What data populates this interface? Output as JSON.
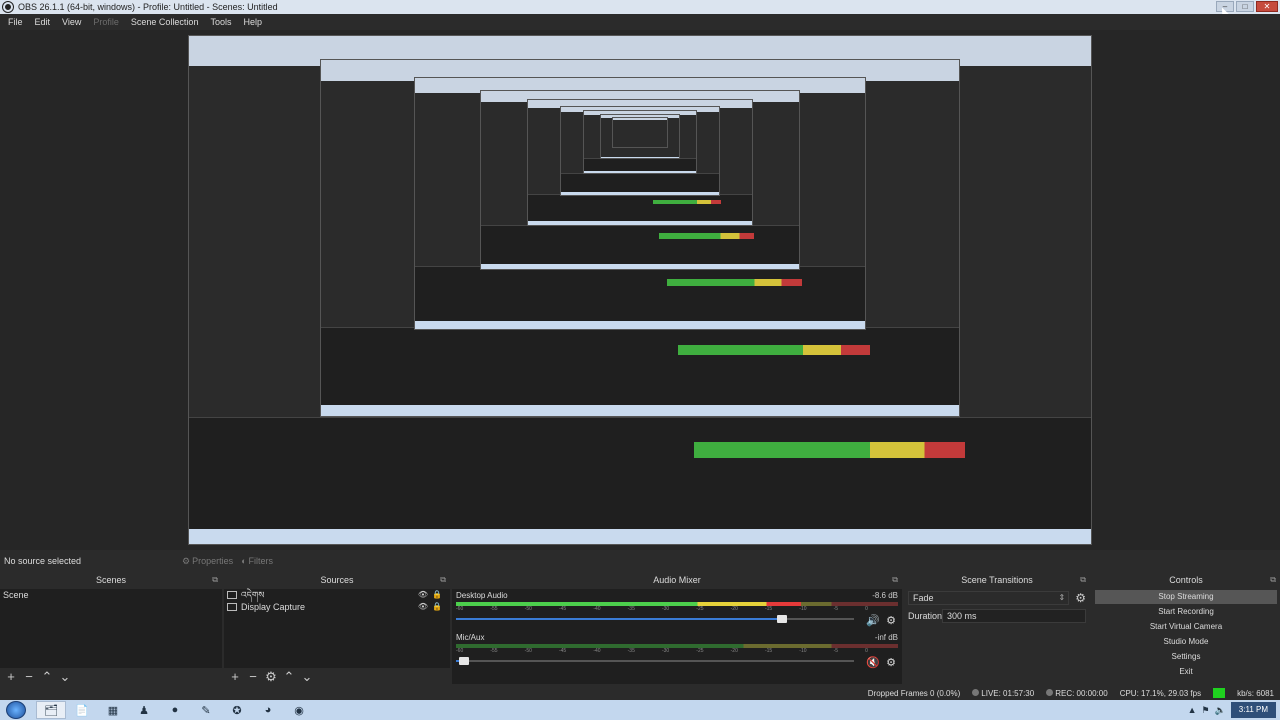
{
  "window": {
    "title": "OBS 26.1.1 (64-bit, windows) - Profile: Untitled - Scenes: Untitled",
    "min": "–",
    "max": "□",
    "close": "✕"
  },
  "menu": [
    "File",
    "Edit",
    "View",
    "Profile",
    "Scene Collection",
    "Tools",
    "Help"
  ],
  "source_toolbar": {
    "no_source": "No source selected",
    "properties": "Properties",
    "filters": "Filters"
  },
  "docks": {
    "scenes": {
      "title": "Scenes",
      "items": [
        "Scene"
      ]
    },
    "sources": {
      "title": "Sources",
      "items": [
        "འདེགས",
        "Display Capture"
      ]
    },
    "mixer": {
      "title": "Audio Mixer",
      "ticks": [
        "-60",
        "-55",
        "-50",
        "-45",
        "-40",
        "-35",
        "-30",
        "-25",
        "-20",
        "-15",
        "-10",
        "-5",
        "0"
      ],
      "channels": [
        {
          "name": "Desktop Audio",
          "db": "-8.6 dB",
          "level": 0.78,
          "volume": 0.82,
          "muted": false
        },
        {
          "name": "Mic/Aux",
          "db": "-inf dB",
          "level": 0,
          "volume": 0.02,
          "muted": true
        }
      ]
    },
    "transitions": {
      "title": "Scene Transitions",
      "transition": "Fade",
      "duration_label": "Duration",
      "duration": "300 ms"
    },
    "controls": {
      "title": "Controls",
      "buttons": [
        "Stop Streaming",
        "Start Recording",
        "Start Virtual Camera",
        "Studio Mode",
        "Settings",
        "Exit"
      ]
    }
  },
  "status": {
    "dropped": "Dropped Frames 0 (0.0%)",
    "live": "LIVE: 01:57:30",
    "rec": "REC: 00:00:00",
    "cpu": "CPU: 17.1%, 29.03 fps",
    "kbs": "kb/s: 6081"
  },
  "taskbar": {
    "clock": "3:11 PM"
  },
  "colors": {
    "accent": "#3a7bd5",
    "meter_green": "#4ccf4c",
    "meter_yellow": "#e6d23a",
    "meter_red": "#e63a3a",
    "status_green": "#1fd11f"
  }
}
